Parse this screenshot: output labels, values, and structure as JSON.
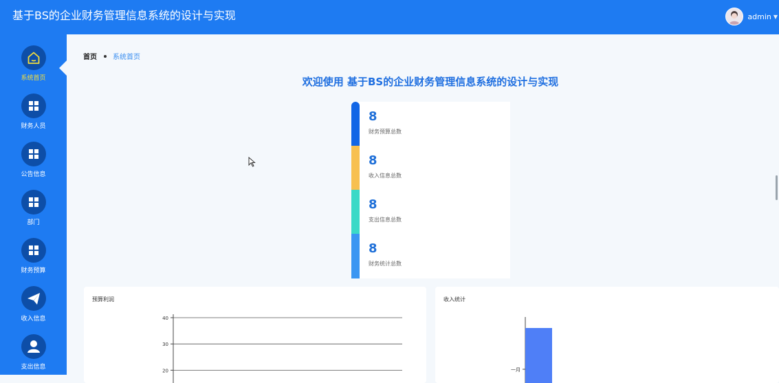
{
  "header": {
    "title": "基于BS的企业财务管理信息系统的设计与实现",
    "username": "admin"
  },
  "sidebar": {
    "items": [
      {
        "label": "系统首页",
        "icon": "home-icon",
        "active": true
      },
      {
        "label": "财务人员",
        "icon": "grid-icon"
      },
      {
        "label": "公告信息",
        "icon": "grid-icon"
      },
      {
        "label": "部门",
        "icon": "grid-icon"
      },
      {
        "label": "财务预算",
        "icon": "grid-icon"
      },
      {
        "label": "收入信息",
        "icon": "send-icon"
      },
      {
        "label": "支出信息",
        "icon": "user-icon"
      }
    ]
  },
  "breadcrumb": {
    "home": "首页",
    "current": "系统首页"
  },
  "welcome": "欢迎使用 基于BS的企业财务管理信息系统的设计与实现",
  "stats": [
    {
      "value": "8",
      "label": "财务预算总数",
      "color": "#1166e6"
    },
    {
      "value": "8",
      "label": "收入信息总数",
      "color": "#f7c051"
    },
    {
      "value": "8",
      "label": "支出信息总数",
      "color": "#3bd9c7"
    },
    {
      "value": "8",
      "label": "财务统计总数",
      "color": "#3a96f2"
    }
  ],
  "colors": {
    "header": "#1e7bf2",
    "sidebar_icon_bg": "#0d4ea8",
    "active_label": "#f5de3b",
    "bar": "#4f7ff7"
  },
  "chart_data": [
    {
      "type": "line",
      "title": "预算利润",
      "yticks": [
        "40",
        "30",
        "20"
      ],
      "ylim": [
        20,
        40
      ],
      "grid": true,
      "series": []
    },
    {
      "type": "bar",
      "title": "收入统计",
      "categories": [
        "一月"
      ],
      "series": [
        {
          "values": [
            36
          ]
        }
      ]
    }
  ]
}
